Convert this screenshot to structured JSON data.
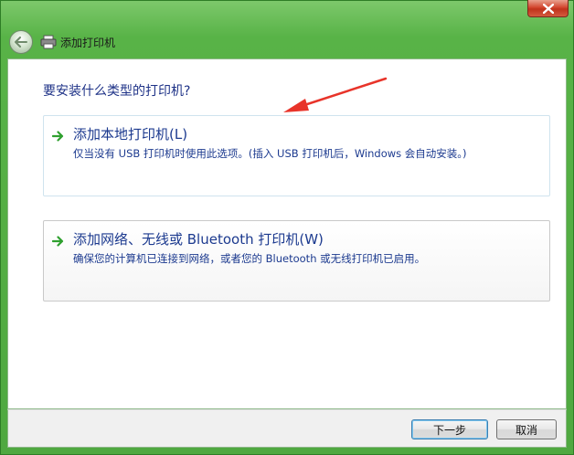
{
  "window": {
    "title": "添加打印机",
    "accent": "#4fa840",
    "close_icon": "close-icon"
  },
  "header": {
    "title": "添加打印机",
    "back_icon": "back-arrow-icon",
    "printer_icon": "printer-icon"
  },
  "main": {
    "question": "要安装什么类型的打印机?",
    "options": [
      {
        "title": "添加本地打印机(L)",
        "description": "仅当没有 USB 打印机时使用此选项。(插入 USB 打印机后，Windows 会自动安装。)",
        "icon": "green-arrow-icon"
      },
      {
        "title": "添加网络、无线或 Bluetooth 打印机(W)",
        "description": "确保您的计算机已连接到网络，或者您的 Bluetooth 或无线打印机已启用。",
        "icon": "green-arrow-icon"
      }
    ]
  },
  "footer": {
    "next_label": "下一步",
    "cancel_label": "取消"
  },
  "annotation": {
    "color": "#e8342a"
  }
}
